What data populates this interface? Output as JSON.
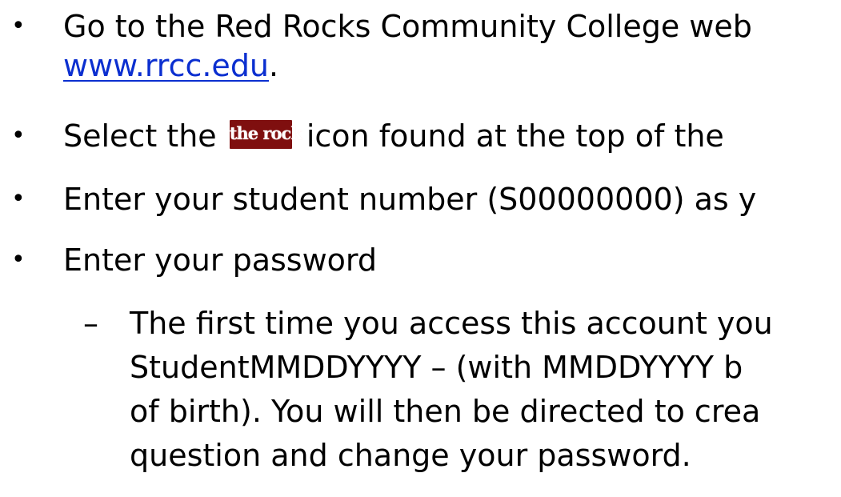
{
  "bullets": [
    {
      "line1": "Go to the Red Rocks Community College web",
      "link_text": "www.rrcc.edu",
      "link_suffix": "."
    },
    {
      "before_icon": "Select the ",
      "icon_text": "the rock",
      "after_icon": " icon found at the top of the"
    },
    {
      "text": "Enter your student number (S00000000) as y"
    },
    {
      "text": "Enter your password",
      "sub": {
        "line1": "The first time you access this account you",
        "line2": "StudentMMDDYYYY – (with MMDDYYYY b",
        "line3": "of birth). You will then be directed to crea",
        "line4": "question  and change your password."
      }
    }
  ],
  "glyphs": {
    "bullet": "•",
    "dash": "–"
  },
  "colors": {
    "link": "#0b2fd0",
    "icon_bg": "#7f0f0f",
    "icon_text": "#ffffff"
  }
}
